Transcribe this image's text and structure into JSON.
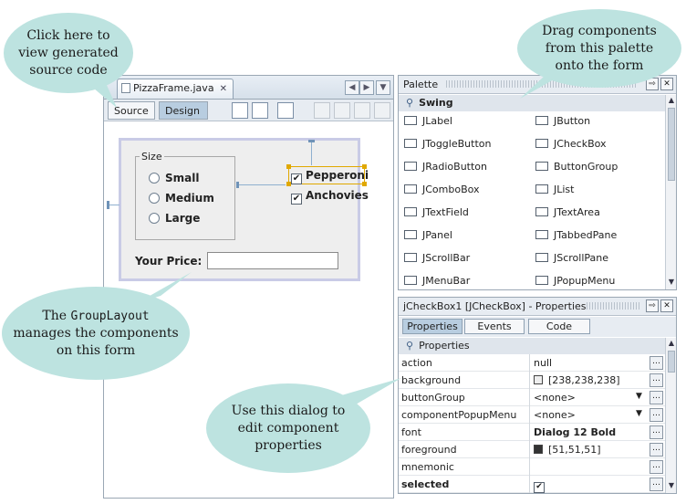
{
  "editor": {
    "file_tab": "PizzaFrame.java",
    "source_label": "Source",
    "design_label": "Design"
  },
  "form": {
    "size_legend": "Size",
    "radios": [
      "Small",
      "Medium",
      "Large"
    ],
    "checkboxes": [
      {
        "label": "Pepperoni",
        "checked": true
      },
      {
        "label": "Anchovies",
        "checked": true
      }
    ],
    "price_label": "Your Price:",
    "price_value": ""
  },
  "palette": {
    "title": "Palette",
    "category": "Swing",
    "items": [
      {
        "label": "JLabel",
        "icon": "label-icon"
      },
      {
        "label": "JButton",
        "icon": "button-icon"
      },
      {
        "label": "JToggleButton",
        "icon": "toggle-button-icon"
      },
      {
        "label": "JCheckBox",
        "icon": "checkbox-icon"
      },
      {
        "label": "JRadioButton",
        "icon": "radio-button-icon"
      },
      {
        "label": "ButtonGroup",
        "icon": "button-group-icon"
      },
      {
        "label": "JComboBox",
        "icon": "combobox-icon"
      },
      {
        "label": "JList",
        "icon": "list-icon"
      },
      {
        "label": "JTextField",
        "icon": "textfield-icon"
      },
      {
        "label": "JTextArea",
        "icon": "textarea-icon"
      },
      {
        "label": "JPanel",
        "icon": "panel-icon"
      },
      {
        "label": "JTabbedPane",
        "icon": "tabbed-pane-icon"
      },
      {
        "label": "JScrollBar",
        "icon": "scrollbar-icon"
      },
      {
        "label": "JScrollPane",
        "icon": "scroll-pane-icon"
      },
      {
        "label": "JMenuBar",
        "icon": "menubar-icon"
      },
      {
        "label": "JPopupMenu",
        "icon": "popup-menu-icon"
      }
    ]
  },
  "properties": {
    "title": "jCheckBox1 [JCheckBox] - Properties",
    "tabs": [
      "Properties",
      "Events",
      "Code"
    ],
    "section": "Properties",
    "rows": [
      {
        "name": "action",
        "value": "null"
      },
      {
        "name": "background",
        "value": "[238,238,238]",
        "swatch": "#eeeeee"
      },
      {
        "name": "buttonGroup",
        "value": "<none>",
        "dropdown": true
      },
      {
        "name": "componentPopupMenu",
        "value": "<none>",
        "dropdown": true
      },
      {
        "name": "font",
        "value": "Dialog 12 Bold",
        "bold_value": true
      },
      {
        "name": "foreground",
        "value": "[51,51,51]",
        "swatch": "#333333"
      },
      {
        "name": "mnemonic",
        "value": ""
      },
      {
        "name": "selected",
        "value": "",
        "checkbox": true,
        "bold_name": true
      }
    ]
  },
  "callouts": {
    "source": [
      "Click here to",
      "view generated",
      "source code"
    ],
    "palette": [
      "Drag components",
      "from this palette",
      "onto the form"
    ],
    "layout_pre": "The ",
    "layout_code": "GroupLayout",
    "layout_rest": [
      "manages the components",
      "on this form"
    ],
    "dialog": [
      "Use this dialog to",
      "edit component",
      "properties"
    ]
  }
}
